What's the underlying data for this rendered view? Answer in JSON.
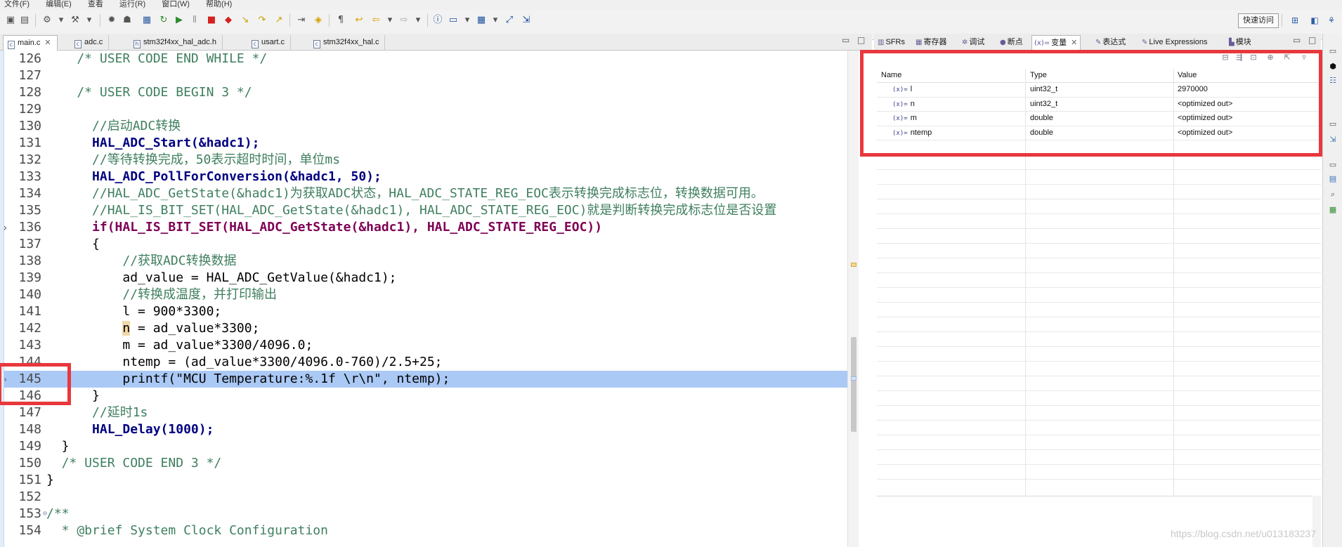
{
  "menubar": {
    "items": [
      "文件(F)",
      "编辑(E)",
      "查看",
      "运行(R)",
      "窗口(W)",
      "帮助(H)"
    ]
  },
  "toolbar": {
    "quick_access": "快速访问",
    "icons": [
      "save-icon",
      "save-all-icon",
      "build-config-icon",
      "hammer-icon",
      "debug-icon",
      "run-icon",
      "resume-icon",
      "suspend-icon",
      "terminate-icon",
      "step-into-icon",
      "step-over-icon",
      "step-return-icon",
      "new-icon",
      "open-type-icon",
      "task-icon",
      "back-icon",
      "forward-icon",
      "info-icon",
      "window-icon",
      "table-icon",
      "fullscreen-icon",
      "export-icon"
    ]
  },
  "editor": {
    "tabs": [
      {
        "label": "main.c",
        "active": true
      },
      {
        "label": "adc.c",
        "active": false
      },
      {
        "label": "stm32f4xx_hal_adc.h",
        "active": false
      },
      {
        "label": "usart.c",
        "active": false
      },
      {
        "label": "stm32f4xx_hal.c",
        "active": false
      }
    ],
    "lines": [
      {
        "n": "126",
        "text": "    /* USER CODE END WHILE */"
      },
      {
        "n": "127",
        "text": ""
      },
      {
        "n": "128",
        "text": "    /* USER CODE BEGIN 3 */"
      },
      {
        "n": "129",
        "text": ""
      },
      {
        "n": "130",
        "text": "      //启动ADC转换"
      },
      {
        "n": "131",
        "text": "      HAL_ADC_Start(&hadc1);"
      },
      {
        "n": "132",
        "text": "      //等待转换完成，50表示超时时间，单位ms"
      },
      {
        "n": "133",
        "text": "      HAL_ADC_PollForConversion(&hadc1, 50);"
      },
      {
        "n": "134",
        "text": "      //HAL_ADC_GetState(&hadc1)为获取ADC状态，HAL_ADC_STATE_REG_EOC表示转换完成标志位，转换数据可用。"
      },
      {
        "n": "135",
        "text": "      //HAL_IS_BIT_SET(HAL_ADC_GetState(&hadc1), HAL_ADC_STATE_REG_EOC)就是判断转换完成标志位是否设置"
      },
      {
        "n": "136",
        "text": "      if(HAL_IS_BIT_SET(HAL_ADC_GetState(&hadc1), HAL_ADC_STATE_REG_EOC))"
      },
      {
        "n": "137",
        "text": "      {"
      },
      {
        "n": "138",
        "text": "          //获取ADC转换数据"
      },
      {
        "n": "139",
        "text": "          ad_value = HAL_ADC_GetValue(&hadc1);"
      },
      {
        "n": "140",
        "text": "          //转换成温度，并打印输出"
      },
      {
        "n": "141",
        "text": "          l = 900*3300;"
      },
      {
        "n": "142",
        "text": "          n = ad_value*3300;"
      },
      {
        "n": "143",
        "text": "          m = ad_value*3300/4096.0;"
      },
      {
        "n": "144",
        "text": "          ntemp = (ad_value*3300/4096.0-760)/2.5+25;"
      },
      {
        "n": "145",
        "text": "          printf(\"MCU Temperature:%.1f \\r\\n\", ntemp);"
      },
      {
        "n": "146",
        "text": "      }"
      },
      {
        "n": "147",
        "text": "      //延时1s"
      },
      {
        "n": "148",
        "text": "      HAL_Delay(1000);"
      },
      {
        "n": "149",
        "text": "  }"
      },
      {
        "n": "150",
        "text": "  /* USER CODE END 3 */"
      },
      {
        "n": "151",
        "text": "}"
      },
      {
        "n": "152",
        "text": ""
      },
      {
        "n": "153",
        "text": "/**"
      },
      {
        "n": "154",
        "text": "  * @brief System Clock Configuration"
      }
    ],
    "current_line": "145"
  },
  "right_panel": {
    "tabs": [
      {
        "label": "SFRs",
        "active": false
      },
      {
        "label": "寄存器",
        "active": false
      },
      {
        "label": "调试",
        "active": false
      },
      {
        "label": "断点",
        "active": false
      },
      {
        "label": "变量",
        "active": true
      },
      {
        "label": "表达式",
        "active": false
      },
      {
        "label": "Live Expressions",
        "active": false
      },
      {
        "label": "模块",
        "active": false
      }
    ],
    "variables": {
      "columns": {
        "name": "Name",
        "type": "Type",
        "value": "Value"
      },
      "rows": [
        {
          "name": "l",
          "type": "uint32_t",
          "value": "2970000"
        },
        {
          "name": "n",
          "type": "uint32_t",
          "value": "<optimized out>"
        },
        {
          "name": "m",
          "type": "double",
          "value": "<optimized out>"
        },
        {
          "name": "ntemp",
          "type": "double",
          "value": "<optimized out>"
        }
      ],
      "var_icon": "(x)="
    }
  },
  "watermark": "https://blog.csdn.net/u013183237",
  "colors": {
    "highlight_box": "#e8383d",
    "current_line_bg": "#abc9f5",
    "comment": "#3f7f5f",
    "function": "#000080",
    "keyword": "#7f0055"
  }
}
